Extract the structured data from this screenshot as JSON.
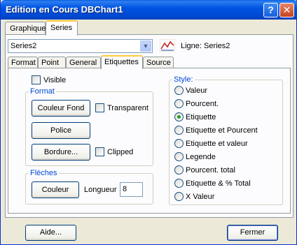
{
  "window": {
    "title": "Edition en Cours DBChart1",
    "help_label": "?",
    "close_label": "✕"
  },
  "outer_tabs": [
    {
      "label": "Graphique"
    },
    {
      "label": "Series"
    }
  ],
  "series_select": {
    "value": "Series2"
  },
  "series_info": {
    "icon": "line-chart-icon",
    "label": "Ligne: Series2"
  },
  "inner_tabs": [
    {
      "label": "Format"
    },
    {
      "label": "Point"
    },
    {
      "label": "General"
    },
    {
      "label": "Etiquettes"
    },
    {
      "label": "Source"
    }
  ],
  "visible_label": "Visible",
  "format_group": {
    "title": "Format",
    "couleur_fond": "Couleur Fond",
    "transparent": "Transparent",
    "police": "Police",
    "bordure": "Bordure...",
    "clipped": "Clipped"
  },
  "fleches_group": {
    "title": "Flèches",
    "couleur": "Couleur",
    "longueur_label": "Longueur",
    "longueur_value": "8"
  },
  "style_group": {
    "title": "Style:",
    "selected": "Etiquette",
    "options": [
      {
        "label": "Valeur"
      },
      {
        "label": "Pourcent."
      },
      {
        "label": "Etiquette"
      },
      {
        "label": "Etiquette et Pourcent"
      },
      {
        "label": "Etiquette et valeur"
      },
      {
        "label": "Legende"
      },
      {
        "label": "Pourcent. total"
      },
      {
        "label": "Etiquette & % Total"
      },
      {
        "label": "X Valeur"
      }
    ]
  },
  "footer": {
    "aide": "Aide...",
    "fermer": "Fermer"
  },
  "colors": {
    "accent": "#0054E3",
    "group_title": "#0046D5",
    "tab_highlight": "#FFC83C",
    "radio_selected": "#21A121"
  }
}
